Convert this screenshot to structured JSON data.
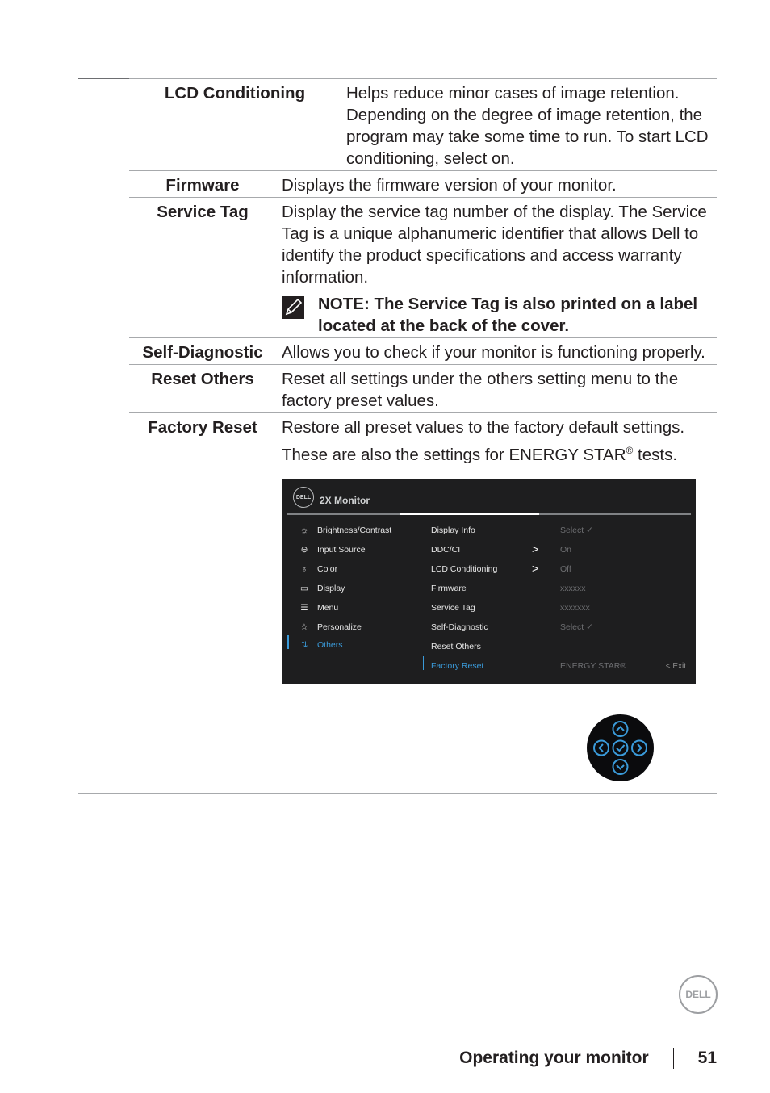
{
  "rows": [
    {
      "label": "LCD Conditioning",
      "description": "Helps reduce minor cases of image retention. Depending on the degree of image retention, the program may take some time to run. To start LCD conditioning, select on."
    },
    {
      "label": "Firmware",
      "description": "Displays the firmware version of your monitor."
    },
    {
      "label": "Service Tag",
      "description": "Display the service tag number of the display. The Service Tag is a unique alphanumeric identifier that allows Dell to identify the product specifications and access warranty information.",
      "note": "NOTE: The Service Tag is also printed on a label located at the back of the cover."
    },
    {
      "label": "Self-Diagnostic",
      "description": "Allows you to check if your monitor is functioning properly."
    },
    {
      "label": "Reset Others",
      "description": "Reset all settings under the others setting menu to the factory preset values."
    },
    {
      "label": "Factory Reset",
      "description": "Restore all preset values to the factory default settings.",
      "description2": "These are also the settings for ENERGY STAR",
      "description2_sup": "®",
      "description2_end": " tests."
    }
  ],
  "osd": {
    "logo": "DELL",
    "title": "2X Monitor",
    "main_menu": [
      {
        "icon": "brightness-icon",
        "label": "Brightness/Contrast"
      },
      {
        "icon": "input-source-icon",
        "label": "Input Source"
      },
      {
        "icon": "color-icon",
        "label": "Color"
      },
      {
        "icon": "display-icon",
        "label": "Display"
      },
      {
        "icon": "menu-icon",
        "label": "Menu"
      },
      {
        "icon": "star-icon",
        "label": "Personalize"
      },
      {
        "icon": "others-icon",
        "label": "Others",
        "active": true
      }
    ],
    "sub_menu": [
      "Display Info",
      "DDC/CI",
      "LCD Conditioning",
      "Firmware",
      "Service Tag",
      "Self-Diagnostic",
      "Reset Others",
      "Factory Reset"
    ],
    "values": [
      "Select ✓",
      "On",
      "Off",
      "xxxxxx",
      "xxxxxxx",
      "Select ✓",
      "",
      "ENERGY STAR®"
    ],
    "exit_label": "Exit",
    "accent": "#3a9ad9"
  },
  "footer": {
    "section": "Operating your monitor",
    "page": "51",
    "logo": "DELL"
  }
}
